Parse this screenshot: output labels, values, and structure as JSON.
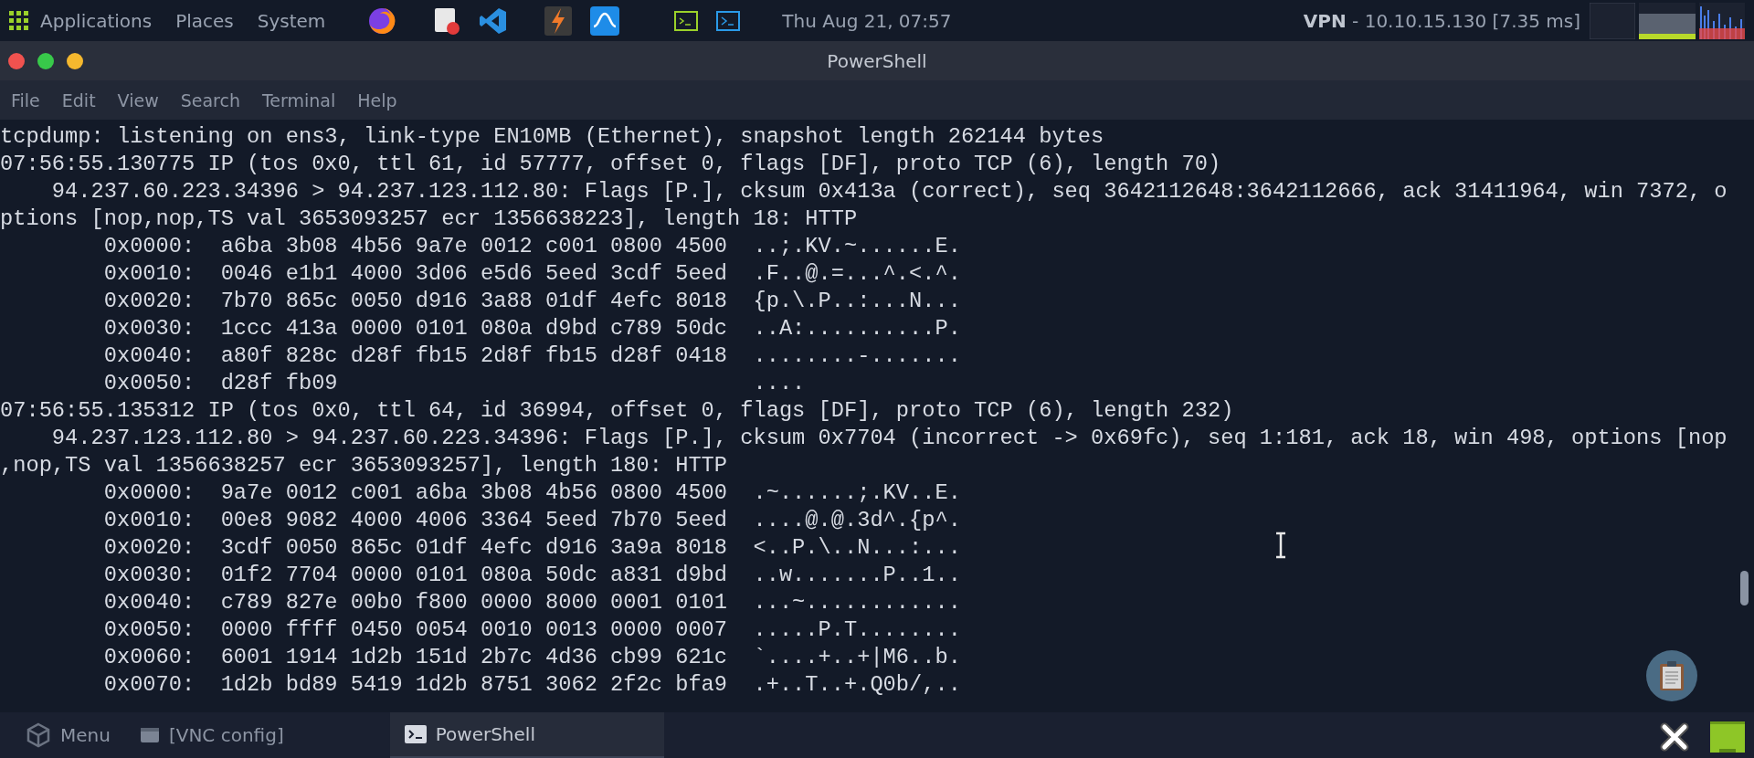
{
  "top_panel": {
    "menus": [
      "Applications",
      "Places",
      "System"
    ],
    "clock": "Thu Aug 21, 07:57",
    "vpn": {
      "label": "VPN",
      "text": " - 10.10.15.130 [7.35 ms]"
    }
  },
  "window": {
    "title": "PowerShell",
    "menu": [
      "File",
      "Edit",
      "View",
      "Search",
      "Terminal",
      "Help"
    ],
    "terminal_lines": [
      "tcpdump: listening on ens3, link-type EN10MB (Ethernet), snapshot length 262144 bytes",
      "07:56:55.130775 IP (tos 0x0, ttl 61, id 57777, offset 0, flags [DF], proto TCP (6), length 70)",
      "    94.237.60.223.34396 > 94.237.123.112.80: Flags [P.], cksum 0x413a (correct), seq 3642112648:3642112666, ack 31411964, win 7372, o",
      "ptions [nop,nop,TS val 3653093257 ecr 1356638223], length 18: HTTP",
      "        0x0000:  a6ba 3b08 4b56 9a7e 0012 c001 0800 4500  ..;.KV.~......E.",
      "        0x0010:  0046 e1b1 4000 3d06 e5d6 5eed 3cdf 5eed  .F..@.=...^.<.^.",
      "        0x0020:  7b70 865c 0050 d916 3a88 01df 4efc 8018  {p.\\.P..:...N...",
      "        0x0030:  1ccc 413a 0000 0101 080a d9bd c789 50dc  ..A:..........P.",
      "        0x0040:  a80f 828c d28f fb15 2d8f fb15 d28f 0418  ........-.......",
      "        0x0050:  d28f fb09                                ....",
      "07:56:55.135312 IP (tos 0x0, ttl 64, id 36994, offset 0, flags [DF], proto TCP (6), length 232)",
      "    94.237.123.112.80 > 94.237.60.223.34396: Flags [P.], cksum 0x7704 (incorrect -> 0x69fc), seq 1:181, ack 18, win 498, options [nop",
      ",nop,TS val 1356638257 ecr 3653093257], length 180: HTTP",
      "        0x0000:  9a7e 0012 c001 a6ba 3b08 4b56 0800 4500  .~......;.KV..E.",
      "        0x0010:  00e8 9082 4000 4006 3364 5eed 7b70 5eed  ....@.@.3d^.{p^.",
      "        0x0020:  3cdf 0050 865c 01df 4efc d916 3a9a 8018  <..P.\\..N...:...",
      "        0x0030:  01f2 7704 0000 0101 080a 50dc a831 d9bd  ..w.......P..1..",
      "        0x0040:  c789 827e 00b0 f800 0000 8000 0001 0101  ...~............",
      "        0x0050:  0000 ffff 0450 0054 0010 0013 0000 0007  .....P.T........",
      "        0x0060:  6001 1914 1d2b 151d 2b7c 4d36 cb99 621c  `....+..+|M6..b.",
      "        0x0070:  1d2b bd89 5419 1d2b 8751 3062 2f2c bfa9  .+..T..+.Q0b/,.."
    ]
  },
  "taskbar": {
    "items": [
      {
        "kind": "menu",
        "label": "Menu",
        "selected": false
      },
      {
        "kind": "window",
        "label": "[VNC config]",
        "selected": false
      },
      {
        "kind": "terminal",
        "label": "PowerShell",
        "selected": true
      }
    ]
  }
}
